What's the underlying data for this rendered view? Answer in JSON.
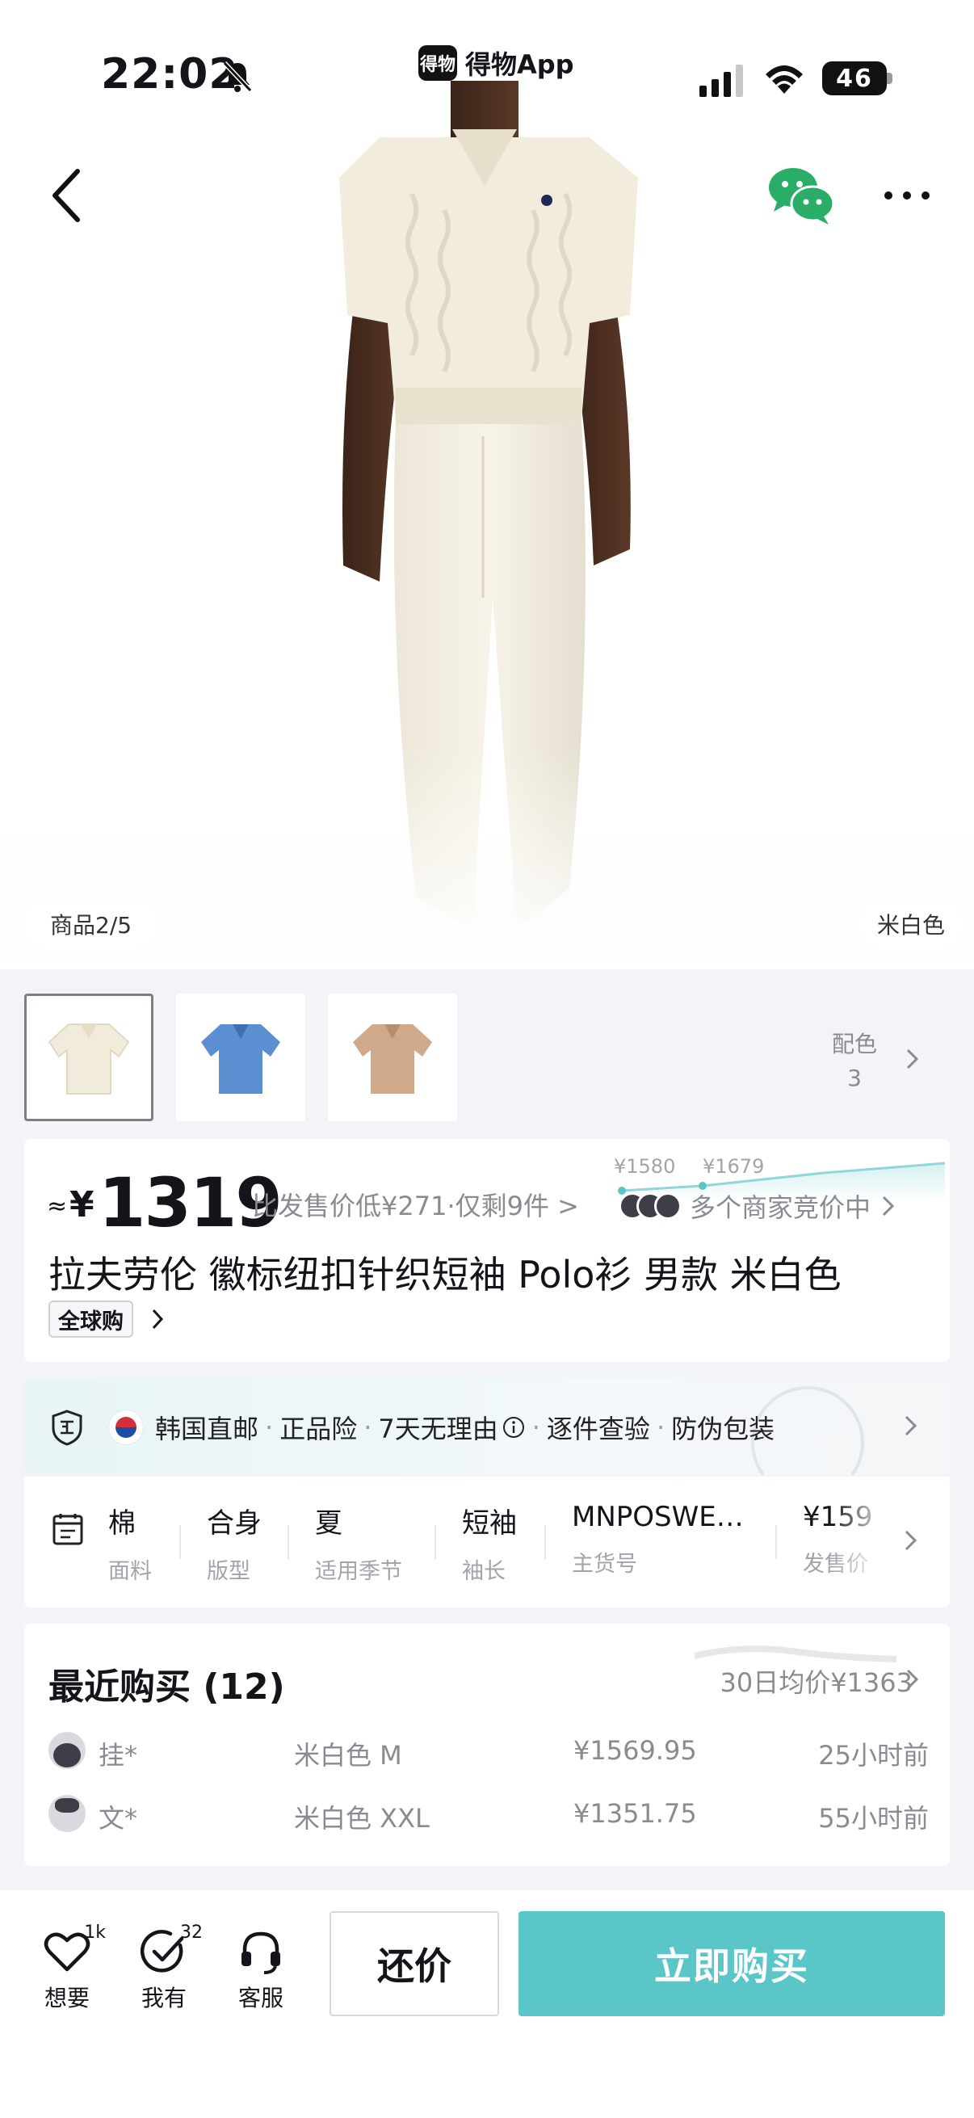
{
  "status_bar": {
    "time": "22:02",
    "app_name": "得物App",
    "app_logo": "得物",
    "battery": "46"
  },
  "gallery": {
    "counter": "商品2/5",
    "color_name": "米白色"
  },
  "thumbnails": {
    "colors": [
      "#f1ebdc",
      "#5b8fd2",
      "#cfa98a"
    ],
    "count_label": "配色",
    "count": "3"
  },
  "price_section": {
    "approx": "≈",
    "currency": "¥",
    "price": "1319",
    "note": "比发售价低¥271·仅剩9件 >",
    "trend_labels": [
      "¥1580",
      "¥1679"
    ],
    "sellers_text": "多个商家竞价中",
    "title": "拉夫劳伦 徽标纽扣针织短袖 Polo衫 男款 米白色",
    "tag": "全球购"
  },
  "services": {
    "items": [
      "韩国直邮",
      "正品险",
      "7天无理由",
      "逐件查验",
      "防伪包装"
    ]
  },
  "attributes": [
    {
      "value": "棉",
      "key": "面料"
    },
    {
      "value": "合身",
      "key": "版型"
    },
    {
      "value": "夏",
      "key": "适用季节"
    },
    {
      "value": "短袖",
      "key": "袖长"
    },
    {
      "value": "MNPOSWE…",
      "key": "主货号"
    },
    {
      "value": "¥159",
      "key": "发售价"
    }
  ],
  "recent_purchases": {
    "title": "最近购买 (12)",
    "avg_price": "30日均价¥1363",
    "rows": [
      {
        "name": "挂*",
        "size": "米白色 M",
        "price": "¥1569.95",
        "time": "25小时前"
      },
      {
        "name": "文*",
        "size": "米白色 XXL",
        "price": "¥1351.75",
        "time": "55小时前"
      }
    ]
  },
  "bottom_bar": {
    "want": {
      "label": "想要",
      "badge": "1k"
    },
    "owned": {
      "label": "我有",
      "badge": "32"
    },
    "service": {
      "label": "客服"
    },
    "bargain_label": "还价",
    "buy_label": "立即购买"
  },
  "colors": {
    "accent": "#5bc6c8",
    "wechat": "#2aae67"
  }
}
